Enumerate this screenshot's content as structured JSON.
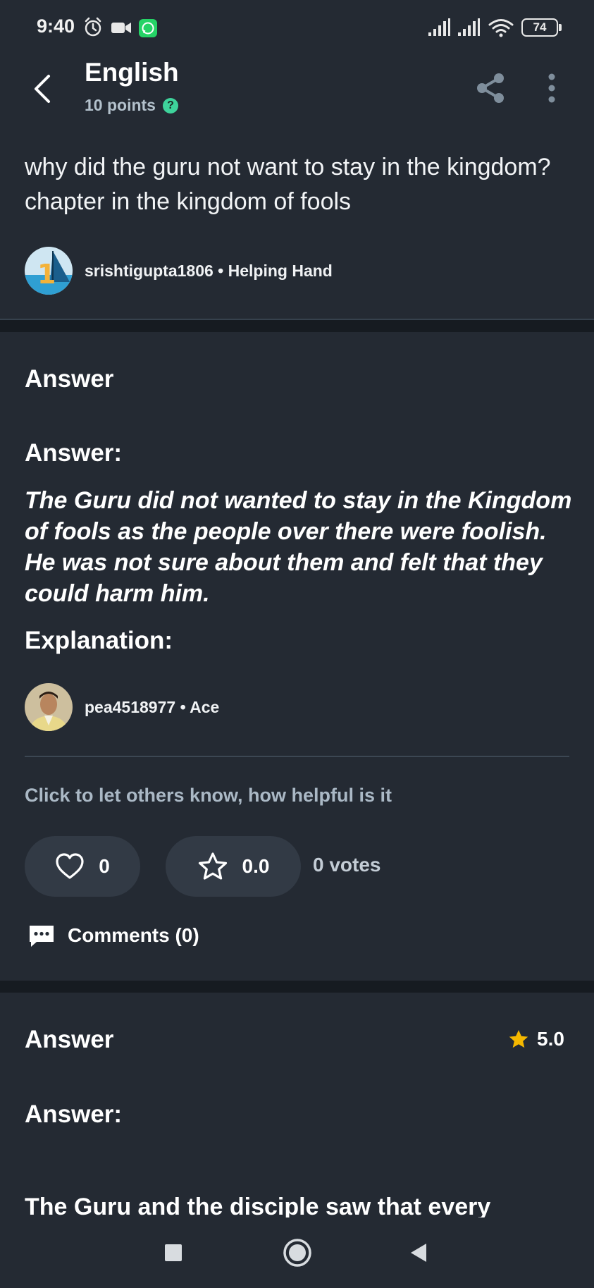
{
  "status_bar": {
    "time": "9:40",
    "battery": "74"
  },
  "header": {
    "subject": "English",
    "points": "10 points",
    "help_glyph": "?"
  },
  "question": {
    "text": "why did the guru not want to stay in the kingdom? chapter in the kingdom of fools",
    "asker": "srishtigupta1806 • Helping Hand"
  },
  "answer1": {
    "heading": "Answer",
    "label_answer": "Answer:",
    "body": "The Guru did not wanted to stay in the Kingdom of fools as the people over there were foolish. He was not sure about them and felt that they could harm him.",
    "label_explanation": "Explanation:",
    "answerer": "pea4518977 • Ace",
    "helpful_prompt": "Click to let others know, how helpful is it",
    "likes": "0",
    "rating": "0.0",
    "votes": "0 votes",
    "comments": "Comments (0)"
  },
  "answer2": {
    "heading": "Answer",
    "rating": "5.0",
    "label_answer": "Answer:",
    "body": "The Guru and the disciple saw that every"
  },
  "colors": {
    "background": "#242a33",
    "section_gap": "#161b21",
    "pill": "#323a45",
    "accent_green": "#3ed39b",
    "star_yellow": "#f5b800",
    "muted_text": "#aab8c5"
  }
}
